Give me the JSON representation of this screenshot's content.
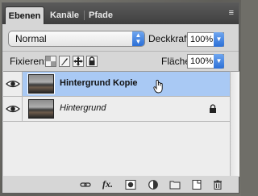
{
  "tabs": [
    "Ebenen",
    "Kanäle",
    "Pfade"
  ],
  "blend_mode": {
    "selected": "Normal"
  },
  "opacity": {
    "label": "Deckkraft:",
    "value": "100%"
  },
  "lock": {
    "label": "Fixieren:"
  },
  "fill": {
    "label": "Fläche:",
    "value": "100%"
  },
  "layers": [
    {
      "name": "Hintergrund Kopie",
      "selected": true,
      "visible": true,
      "locked": false
    },
    {
      "name": "Hintergrund",
      "selected": false,
      "visible": true,
      "locked": true
    }
  ],
  "toolbar": {
    "fx_label": "fx."
  },
  "colors": {
    "selection": "#a9c9f4",
    "panel": "#d6d6d6",
    "accent": "#2c6fd6"
  }
}
